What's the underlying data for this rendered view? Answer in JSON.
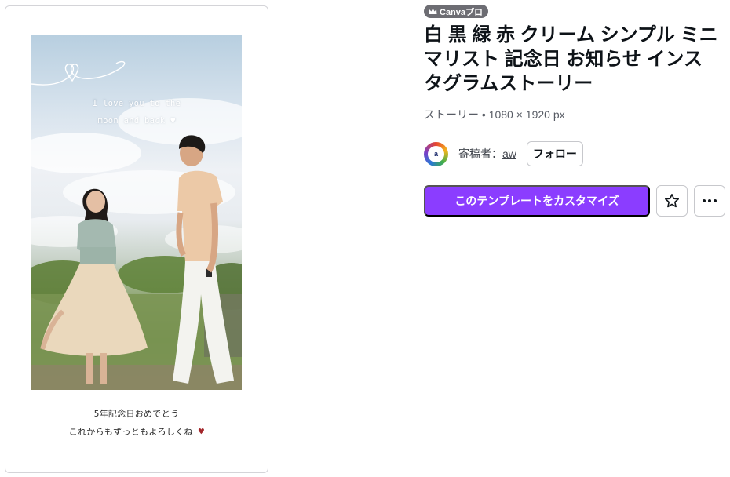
{
  "preview": {
    "caption_line1": "I love you to the",
    "caption_line2": "moon and back",
    "caption_heart": "♥",
    "message_line1": "5年記念日おめでとう",
    "message_line2": "これからもずっともよろしくね",
    "message_heart": "♥",
    "heart_color": "#a3262a"
  },
  "badge": {
    "label": "Canvaプロ",
    "icon": "crown-icon"
  },
  "template": {
    "title": "白 黒 緑 赤 クリーム シンプル ミニマリスト 記念日 お知らせ インスタグラムストーリー",
    "meta": "ストーリー • 1080 × 1920 px"
  },
  "author": {
    "label": "寄稿者：",
    "name": "aw",
    "follow_label": "フォロー"
  },
  "actions": {
    "customize_label": "このテンプレートをカスタマイズ",
    "accent_color": "#8b3dff",
    "favorite_icon": "star-icon",
    "more_icon": "more-icon"
  }
}
